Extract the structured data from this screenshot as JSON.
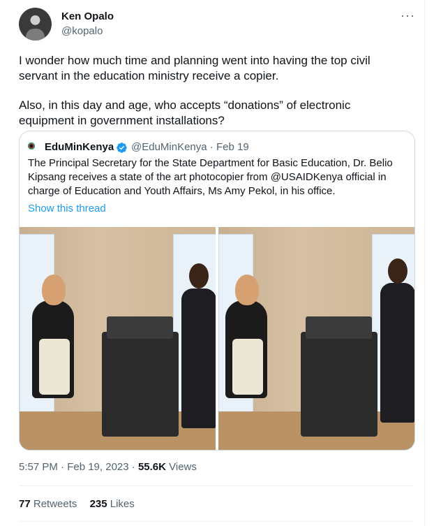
{
  "author": {
    "name": "Ken Opalo",
    "handle": "@kopalo"
  },
  "more_label": "···",
  "body": [
    "I wonder how much time and planning went into having the top civil servant in the education ministry receive a copier.",
    "Also, in this day and age, who accepts “donations” of electronic equipment in government installations?"
  ],
  "quote": {
    "name": "EduMinKenya",
    "handle": "@EduMinKenya",
    "separator": " · ",
    "date": "Feb 19",
    "text": "The Principal Secretary for the State Department for Basic Education, Dr. Belio Kipsang receives a state of the art photocopier  from @USAIDKenya official in charge of Education and Youth Affairs, Ms Amy Pekol, in his office.",
    "show_thread": "Show this thread"
  },
  "timestamp": {
    "time_date": "5:57 PM · Feb 19, 2023 · ",
    "views_count": "55.6K",
    "views_label": " Views"
  },
  "stats": {
    "retweets_count": "77",
    "retweets_label": " Retweets",
    "likes_count": "235",
    "likes_label": " Likes"
  },
  "colors": {
    "accent": "#1d9bf0",
    "secondary_text": "#536471",
    "border": "#cfd9de"
  }
}
